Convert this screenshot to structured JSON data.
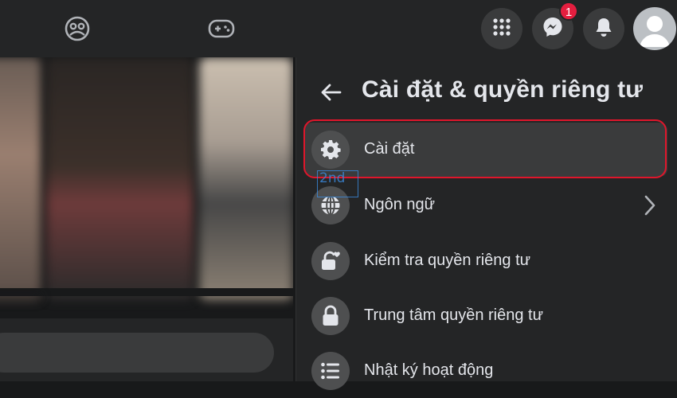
{
  "topbar": {
    "icons": [
      "groups-icon",
      "gaming-icon",
      "menu-grid-icon",
      "messenger-icon",
      "notifications-icon",
      "profile-avatar"
    ],
    "messenger_badge": "1"
  },
  "panel": {
    "title": "Cài đặt & quyền riêng tư",
    "items": [
      {
        "label": "Cài đặt",
        "icon": "gear-icon",
        "selected": true
      },
      {
        "label": "Ngôn ngữ",
        "icon": "globe-icon",
        "has_chevron": true
      },
      {
        "label": "Kiểm tra quyền riêng tư",
        "icon": "lock-heart-icon"
      },
      {
        "label": "Trung tâm quyền riêng tư",
        "icon": "lock-icon"
      },
      {
        "label": "Nhật ký hoạt động",
        "icon": "list-icon"
      }
    ]
  },
  "watermark": {
    "text": "2nd"
  },
  "colors": {
    "background": "#18191a",
    "surface": "#242526",
    "hover": "#3a3b3c",
    "highlight_border": "#e0162b",
    "badge": "#e41e3f"
  }
}
